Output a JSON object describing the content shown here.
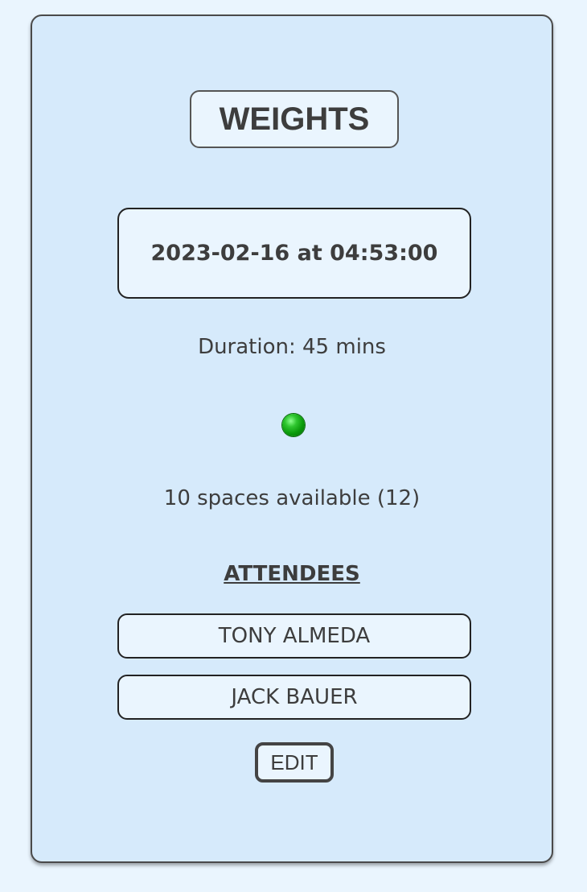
{
  "class_card": {
    "title": "WEIGHTS",
    "datetime": "2023-02-16 at 04:53:00",
    "duration": "Duration: 45 mins",
    "status_icon": "green-status-dot",
    "status_color": "#0a9a0a",
    "spaces": "10 spaces available (12)",
    "attendees_heading": "ATTENDEES",
    "attendees": [
      "TONY ALMEDA",
      "JACK BAUER"
    ],
    "edit_label": "EDIT"
  },
  "colors": {
    "page_background": "#eaf5fe",
    "card_background": "#d6eafb",
    "text": "#3d3d3d"
  }
}
